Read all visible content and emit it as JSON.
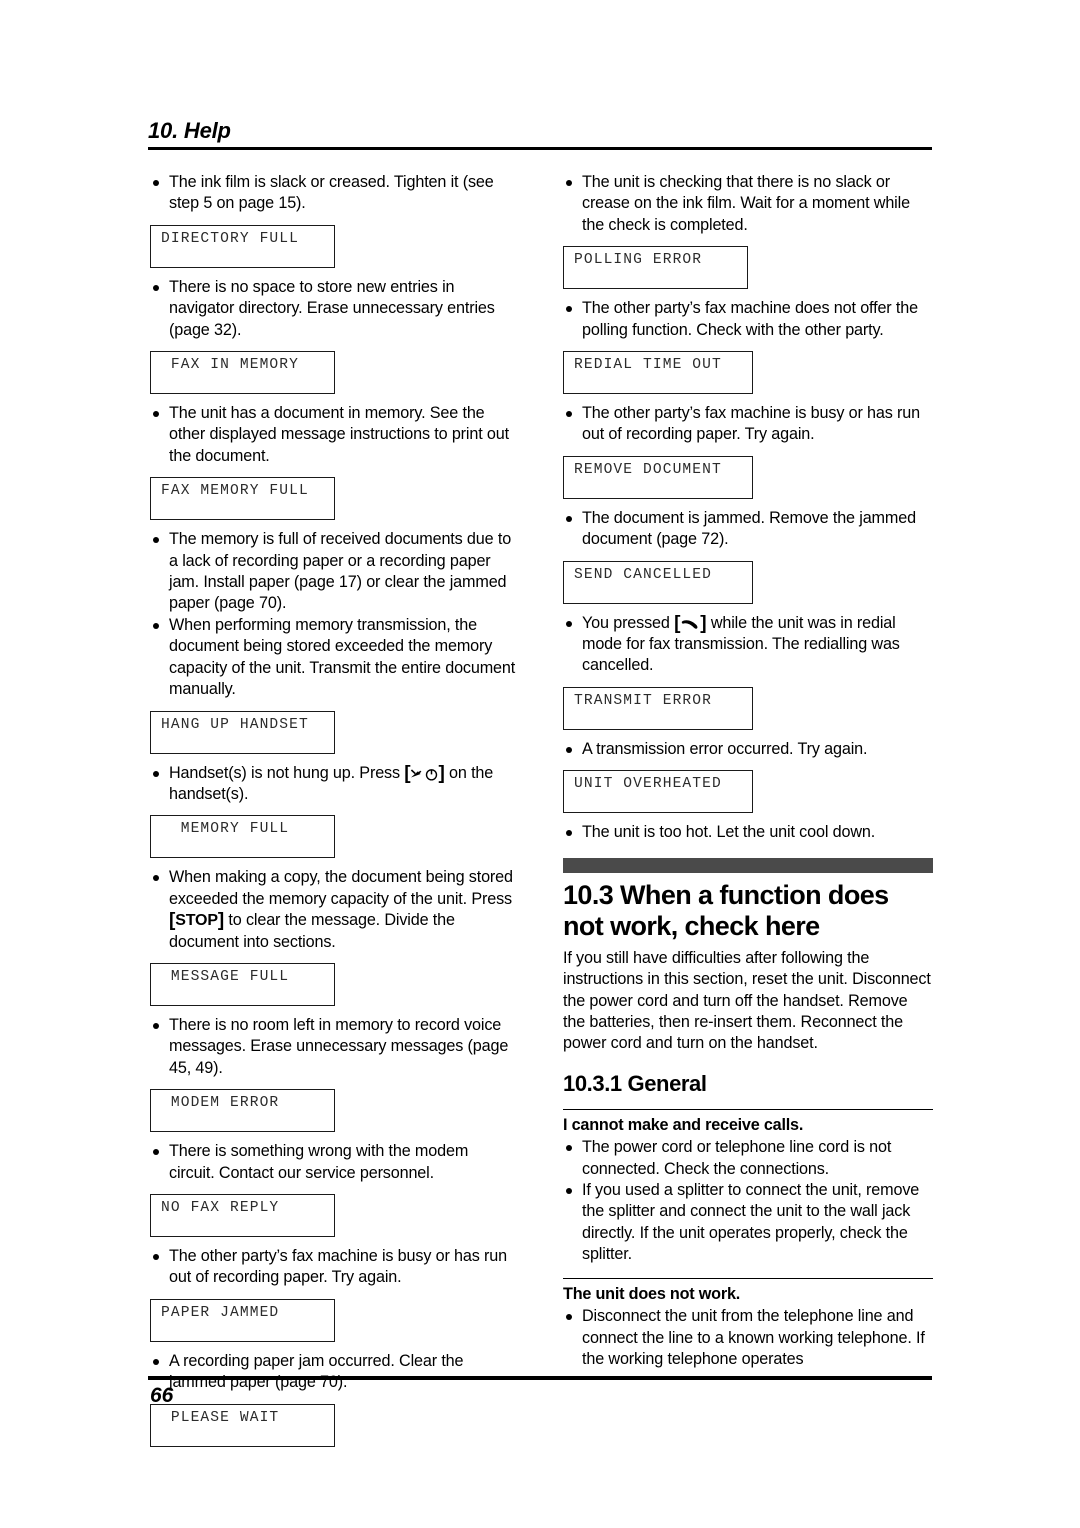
{
  "running_head": {
    "title": "10. Help"
  },
  "footer": {
    "page_number": "66"
  },
  "left_column": {
    "b1": "The ink film is slack or creased. Tighten it (see step 5 on page 15).",
    "lcd1": "DIRECTORY FULL",
    "b2": "There is no space to store new entries in navigator directory. Erase unnecessary entries (page 32).",
    "lcd2": " FAX IN MEMORY",
    "b3": "The unit has a document in memory. See the other displayed message instructions to print out the document.",
    "lcd3": "FAX MEMORY FULL",
    "b4": "The memory is full of received documents due to a lack of recording paper or a recording paper jam. Install paper (page 17) or clear the jammed paper (page 70).",
    "b5": "When performing memory transmission, the document being stored exceeded the memory capacity of the unit. Transmit the entire document manually.",
    "lcd4": "HANG UP HANDSET",
    "b6_pre": "Handset(s) is not hung up. Press ",
    "b6_key": "cancel-power-key",
    "b6_post": " on the handset(s).",
    "lcd5": "  MEMORY FULL",
    "b7_pre": "When making a copy, the document being stored exceeded the memory capacity of the unit. Press ",
    "b7_key": "STOP",
    "b7_post": " to clear the message. Divide the document into sections.",
    "lcd6": " MESSAGE FULL",
    "b8": "There is no room left in memory to record voice messages. Erase unnecessary messages (page 45, 49).",
    "lcd7": " MODEM ERROR",
    "b9": "There is something wrong with the modem circuit. Contact our service personnel.",
    "lcd8": "NO FAX REPLY",
    "b10": "The other party’s fax machine is busy or has run out of recording paper. Try again.",
    "lcd9": "PAPER JAMMED",
    "b11": "A recording paper jam occurred. Clear the jammed paper (page 70).",
    "lcd10": " PLEASE WAIT"
  },
  "right_column": {
    "b1": "The unit is checking that there is no slack or crease on the ink film. Wait for a moment while the check is completed.",
    "lcd1": "POLLING ERROR",
    "b2": "The other party’s fax machine does not offer the polling function. Check with the other party.",
    "lcd2": "REDIAL TIME OUT",
    "b3": "The other party’s fax machine is busy or has run out of recording paper. Try again.",
    "lcd3": "REMOVE DOCUMENT",
    "b4": "The document is jammed. Remove the jammed document (page 72).",
    "lcd4": "SEND CANCELLED",
    "b5_pre": "You pressed ",
    "b5_key": "handset-hook-key",
    "b5_post": " while the unit was in redial mode for fax transmission. The redialling was cancelled.",
    "lcd5": "TRANSMIT ERROR",
    "b6": "A transmission error occurred. Try again.",
    "lcd6": "UNIT OVERHEATED",
    "b7": "The unit is too hot. Let the unit cool down.",
    "section": {
      "heading": "10.3 When a function does not work, check here",
      "body": "If you still have difficulties after following the instructions in this section, reset the unit. Disconnect the power cord and turn off the handset. Remove the batteries, then re-insert them. Reconnect the power cord and turn on the handset.",
      "subheading": "10.3.1 General",
      "q1_title": "I cannot make and receive calls.",
      "q1_b1": "The power cord or telephone line cord is not connected. Check the connections.",
      "q1_b2": "If you used a splitter to connect the unit, remove the splitter and connect the unit to the wall jack directly. If the unit operates properly, check the splitter.",
      "q2_title": "The unit does not work.",
      "q2_b1": "Disconnect the unit from the telephone line and connect the line to a known working telephone. If the working telephone operates"
    }
  },
  "colors": {
    "ink": "#000000",
    "paper": "#ffffff",
    "section_bar": "#4a4a4a",
    "lcd_text": "#2b2b2b"
  }
}
